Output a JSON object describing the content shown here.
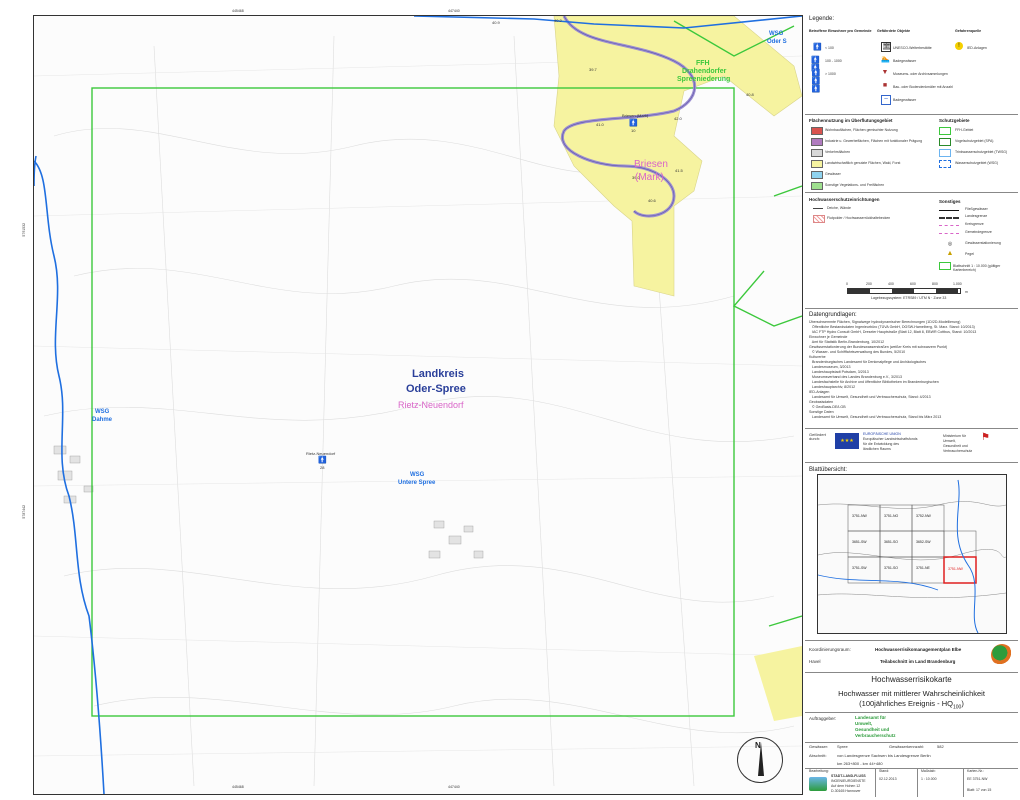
{
  "map": {
    "top_coords": [
      "445468",
      "447440"
    ],
    "bottom_coords": [
      "445468",
      "447440"
    ],
    "side_coords_upper": "5791532",
    "side_coords_lower": "5787442",
    "labels": {
      "landkreis": "Landkreis",
      "oder_spree": "Oder-Spree",
      "rietz_neuendorf": "Rietz-Neuendorf",
      "briesen": "Briesen",
      "mark": "(Mark)",
      "wsg_dahme_1": "WSG",
      "wsg_dahme_2": "Dahme",
      "wsg_untere_1": "WSG",
      "wsg_untere_2": "Untere Spree",
      "wsg_oder_1": "WSG",
      "wsg_oder_2": "Oder S",
      "ffh_1": "FFH",
      "ffh_2": "Drahendorfer",
      "ffh_3": "Spreeniederung",
      "pegel_name": "Briesen (Mark)",
      "pegel_value": "10",
      "rietz_pin_name": "Rietz-Neuendorf",
      "rietz_pin_value": "28"
    },
    "water_levels": [
      "40.9",
      "40.2",
      "39.7",
      "40.8",
      "42.0",
      "41.0",
      "39.0",
      "41.5",
      "40.6"
    ]
  },
  "legend": {
    "title": "Legende:",
    "col_betroffene": "Betroffene Einwohner pro Gemeinde",
    "col_objekte": "Gefährdete Objekte",
    "col_quelle": "Gefahrenquelle",
    "einwohner": [
      "< 100",
      "100 - 1000",
      "> 1000"
    ],
    "objekte": [
      "UNESCO-Welterbestätte",
      "Badegewässer",
      "Museums- oder Archivsammlungen",
      "Bau- oder Bodendenkmäler mit Anzahl",
      "Badegewässer"
    ],
    "quelle": [
      "IED-Anlagen"
    ],
    "flaechennutzung_title": "Flächennutzung im Überflutungsgebiet",
    "flaechennutzung": [
      "Wohnbauflächen, Flächen gemischter Nutzung",
      "Industrie u. Gewerbeflächen, Flächen mit funktionaler Prägung",
      "Verkehrsflächen",
      "Landwirtschaftlich genutzte Flächen, Wald, Forst",
      "Gewässer",
      "Sonstige Vegetations- und Freiflächen"
    ],
    "flaechennutzung_colors": [
      "#d9534f",
      "#b07bbf",
      "#d8d8d8",
      "#f6f3a0",
      "#8fd3ef",
      "#9fe08f"
    ],
    "schutzgebiete_title": "Schutzgebiete",
    "schutzgebiete": [
      "FFH-Gebiet",
      "Vogelschutzgebiet (SPA)",
      "Trinkwasserschutzgebiet (TWSG)",
      "Wasserschutzgebiet (WSG)"
    ],
    "hws_title": "Hochwasserschutzeinrichtungen",
    "hws": [
      "Deiche, Wände",
      "Flutpolder / Hochwasserrückhaltebecken"
    ],
    "sonstiges_title": "Sonstiges",
    "sonstiges": [
      "Fließgewässer",
      "Landesgrenze",
      "Kreisgrenze",
      "Gemeindegrenze",
      "Gewässerstationierung",
      "Pegel",
      "Blattschnitt 1 : 10.000 (gültiger Kartenbereich)"
    ],
    "scale_ticks": [
      "0",
      "200",
      "400",
      "600",
      "800",
      "1.000"
    ],
    "scale_unit": "m",
    "projection": "Lagebezugssystem: ETRS89 / UTM N · Zone 33"
  },
  "datengrundlagen": {
    "title": "Datengrundlagen:",
    "lines": [
      "Überschwemmte Flächen, Signalwege hydrodynamischer Berechnungen (1D/2D-Modellierung)",
      "   Öffentliche Bestandsdaten Ingenieurbüro (TÜVA GmbH, DGSW-Hamelberg, St. Marz. Stand: 10/2013)",
      "   IAC FTP Hydro Consult GmbH, Dreseler Hauptstraße (Blatt 12, Blatt 8, EBWR Cottbus, Stand: 10/2013",
      "Einwohner je Gemeinde",
      "   Amt für Statistik Berlin-Brandenburg, 10/2012",
      "Gewässerstationierung der Bundeswasserstraßen (weißer Kreis mit schwarzem Punkt)",
      "   © Wasser- und Schifffahrtsverwaltung des Bundes, 5/2010",
      "Kulturerbe",
      "   Brandenburgisches Landesamt für Denkmalpflege und Archäologisches",
      "   Landesmuseum, 3/2013",
      "   Landeshauptstadt Potsdam, 3/2013",
      "   Museumsverband des Landes Brandenburg e.V., 3/2013",
      "   Landesfachstelle für Archive und öffentliche Bibliotheken im Brandenburgischen",
      "   Landeshauptarchiv, 8/2012",
      "IED-Anlagen",
      "   Landesamt für Umwelt, Gesundheit und Verbraucherschutz, Stand: 4/2013",
      "Geobasisdaten",
      "   © GeoBasis-DE/LGB",
      "Sonstige Daten",
      "   Landesamt für Umwelt, Gesundheit und Verbraucherschutz, Stand bis März 2013"
    ]
  },
  "funding": {
    "label": "Gefördert durch:",
    "eu_text": [
      "EUROPÄISCHE UNION",
      "Europäischer Landwirtschaftsfonds",
      "für die Entwicklung des",
      "ländlichen Raums"
    ],
    "ministry": [
      "Ministerium für",
      "Umwelt,",
      "Gesundheit und",
      "Verbraucherschutz"
    ]
  },
  "overview": {
    "title": "Blattübersicht:",
    "tiles": [
      "3751-NW",
      "3751-NO",
      "3752-NW",
      "3651-SW",
      "3651-SO",
      "3652-SW",
      "3751-SW",
      "3751-SO",
      "3751-NE"
    ],
    "current_tile": "3751-NW"
  },
  "coordination": {
    "label": "Koordinierungsraum:",
    "value": "Havel",
    "plan_title": "Hochwasserrisikomanagementplan Elbe",
    "plan_sub": "Teilabschnitt im Land Brandenburg"
  },
  "title_block": {
    "line1": "Hochwasserrisikokarte",
    "line2": "Hochwasser mit mittlerer Wahrscheinlichkeit",
    "line3": "(100jährliches Ereignis - HQ",
    "line3_sub": "100",
    "line3_end": ")"
  },
  "auftraggeber": {
    "label": "Auftraggeber:",
    "value": [
      "Landesamt für",
      "Umwelt,",
      "Gesundheit und",
      "Verbraucherschutz"
    ]
  },
  "gewaesser": {
    "label": "Gewässer:",
    "value": "Spree",
    "count_label": "Gewässerkennzahl:",
    "count_value": "582",
    "abschnitt_label": "Abschnitt:",
    "abschnitt_value": "von Landesgrenze Sachsen bis Landesgrenze Berlin",
    "km_value": "km 263+800 - km 44+480"
  },
  "footer": {
    "bearbeitung_label": "Bearbeitung:",
    "company": [
      "STADT-LAND-FLUSS",
      "INGENIEURDIENSTE",
      "Auf dem Hohen 12",
      "D-30165 Hannover"
    ],
    "stand_label": "Stand:",
    "stand_value": "02.12.2013",
    "massstab_label": "Maßstab:",
    "massstab_value": "1 : 10.000",
    "karte_label": "Karten-Nr.:",
    "karte_value": "EE 3751-NW",
    "blatt_value": "Blatt: 17 von 15"
  },
  "compass_letter": "N",
  "colors": {
    "ffh_green": "#3cc83c",
    "water_blue": "#1f6fe0",
    "flood_yellow": "#f6f3a0",
    "river_violet": "#9c8fd1",
    "label_violet": "#d965c8",
    "label_dark": "#2a3f9a"
  }
}
